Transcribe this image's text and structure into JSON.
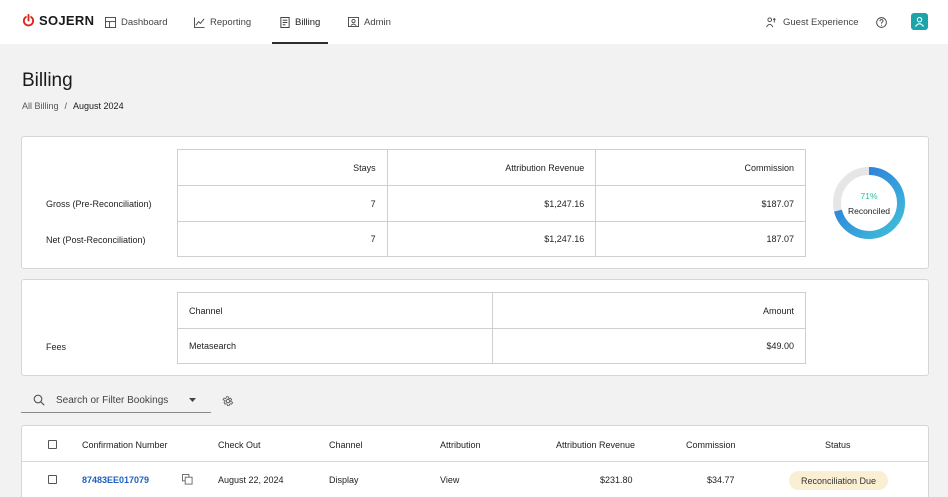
{
  "brand": {
    "name": "SOJERN",
    "accent": "#e2231a"
  },
  "nav": {
    "items": [
      {
        "label": "Dashboard",
        "icon": "dashboard-icon"
      },
      {
        "label": "Reporting",
        "icon": "reporting-icon"
      },
      {
        "label": "Billing",
        "icon": "billing-icon",
        "active": true
      },
      {
        "label": "Admin",
        "icon": "admin-icon"
      }
    ],
    "guest_experience": "Guest Experience",
    "help_icon": "help-icon",
    "avatar_icon": "user-icon",
    "avatar_color": "#1ea3a8"
  },
  "page": {
    "title": "Billing",
    "breadcrumb": {
      "root": "All Billing",
      "separator": "/",
      "current": "August 2024"
    }
  },
  "summary": {
    "headers": [
      "Stays",
      "Attribution Revenue",
      "Commission"
    ],
    "rows": [
      {
        "label": "Gross (Pre-Reconciliation)",
        "stays": "7",
        "revenue": "$1,247.16",
        "commission": "$187.07"
      },
      {
        "label": "Net (Post-Reconciliation)",
        "stays": "7",
        "revenue": "$1,247.16",
        "commission": "187.07"
      }
    ],
    "reconciled": {
      "percent": "71%",
      "value": 71,
      "label": "Reconciled",
      "color_start": "#3fc1d9",
      "color_end": "#2a6fdb",
      "track": "#e6e6e6"
    }
  },
  "fees": {
    "label": "Fees",
    "headers": [
      "Channel",
      "Amount"
    ],
    "rows": [
      {
        "channel": "Metasearch",
        "amount": "$49.00"
      }
    ]
  },
  "search": {
    "placeholder": "Search or Filter Bookings",
    "icon": "search-icon",
    "settings_icon": "gear-icon"
  },
  "bookings": {
    "headers": [
      "Confirmation Number",
      "Check Out",
      "Channel",
      "Attribution",
      "Attribution Revenue",
      "Commission",
      "Status"
    ],
    "rows": [
      {
        "confirmation": "87483EE017079",
        "check_out": "August 22, 2024",
        "channel": "Display",
        "attribution": "View",
        "revenue": "$231.80",
        "commission": "$34.77",
        "status": "Reconciliation Due"
      }
    ]
  }
}
